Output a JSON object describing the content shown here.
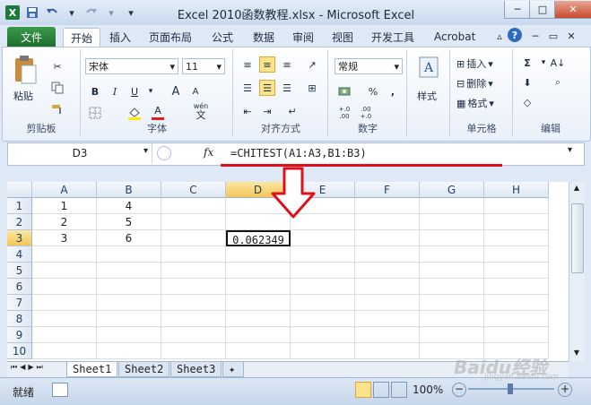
{
  "window": {
    "title": "Excel 2010函数教程.xlsx - Microsoft Excel",
    "app_icon": "X",
    "qat": [
      "save-icon",
      "undo-icon",
      "redo-icon",
      "customize-icon"
    ],
    "controls": [
      "minimize",
      "maximize",
      "close"
    ],
    "control_glyphs": [
      "─",
      "□",
      "✕"
    ]
  },
  "menu": {
    "tabs": [
      "文件",
      "开始",
      "插入",
      "页面布局",
      "公式",
      "数据",
      "审阅",
      "视图",
      "开发工具",
      "Acrobat"
    ],
    "active": "开始"
  },
  "ribbon": {
    "clipboard": {
      "label": "剪贴板",
      "paste": "粘贴"
    },
    "font": {
      "label": "字体",
      "name": "宋体",
      "size": "11",
      "bold": "B",
      "italic": "I",
      "underline": "U",
      "grow": "A",
      "shrink": "A",
      "color_letter": "A",
      "wen": "wén",
      "wen_char": "文"
    },
    "alignment": {
      "label": "对齐方式"
    },
    "number": {
      "label": "数字",
      "format": "常规",
      "percent": "%",
      "comma": ",",
      "inc": "+.0",
      "inc2": ".00",
      "dec": ".00",
      "dec2": "+.0"
    },
    "styles": {
      "label": "样式"
    },
    "cells": {
      "label": "单元格",
      "insert": "插入",
      "delete": "删除",
      "format": "格式"
    },
    "editing": {
      "label": "编辑",
      "sum": "Σ"
    },
    "colors": {
      "font_color_bar": "#e02020",
      "fill_bar": "#ffee00"
    }
  },
  "formula_bar": {
    "name_box": "D3",
    "fx": "fx",
    "formula": "=CHITEST(A1:A3,B1:B3)"
  },
  "sheet": {
    "columns": [
      "A",
      "B",
      "C",
      "D",
      "E",
      "F",
      "G",
      "H"
    ],
    "rows": [
      "1",
      "2",
      "3",
      "4",
      "5",
      "6",
      "7",
      "8",
      "9",
      "10"
    ],
    "cells": {
      "A1": "1",
      "B1": "4",
      "A2": "2",
      "B2": "5",
      "A3": "3",
      "B3": "6",
      "D3": "0.062349"
    },
    "active_cell": "D3",
    "tabs": [
      "Sheet1",
      "Sheet2",
      "Sheet3"
    ],
    "active_tab": "Sheet1"
  },
  "status": {
    "mode": "就绪",
    "zoom": "100%",
    "zoom_minus": "−",
    "zoom_plus": "+"
  },
  "annotations": {
    "underline_color": "#e0101a",
    "arrow_color": "#e0101a"
  },
  "watermark": {
    "brand": "Baidu",
    "suffix": "经验",
    "url": "jingyan.baidu.com"
  }
}
